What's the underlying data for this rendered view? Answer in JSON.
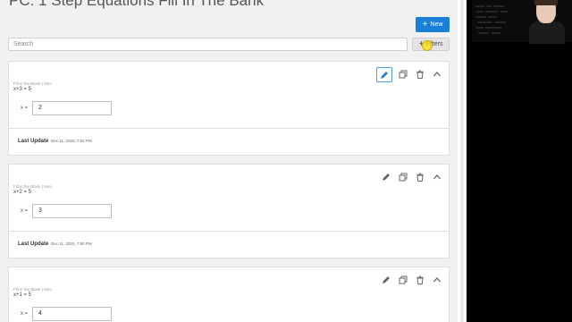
{
  "page": {
    "title": "PC: 1 Step Equations Fill In The Bank"
  },
  "toolbar": {
    "new_label": "New",
    "search_placeholder": "Search",
    "filters_label": "Filters"
  },
  "colors": {
    "accent": "#1a7fd6",
    "background": "#f1f1f1",
    "card": "#ffffff"
  },
  "icons": {
    "edit": "pencil-icon",
    "copy": "copy-icon",
    "delete": "trash-icon",
    "collapse": "chevron-up-icon"
  },
  "items": [
    {
      "category": "Fill in the Blank | Item",
      "equation": "x+3 = 5",
      "variable_label": "x =",
      "answer": "2",
      "update_label": "Last Update",
      "update_date": "Dec 11, 2020, 7:51 PM",
      "editing": true
    },
    {
      "category": "Fill in the Blank | Item",
      "equation": "x+2 = 5",
      "variable_label": "x =",
      "answer": "3",
      "update_label": "Last Update",
      "update_date": "Dec 11, 2020, 7:50 PM",
      "editing": false
    },
    {
      "category": "Fill in the Blank | Item",
      "equation": "x+1 = 5",
      "variable_label": "x =",
      "answer": "4",
      "editing": false
    }
  ]
}
